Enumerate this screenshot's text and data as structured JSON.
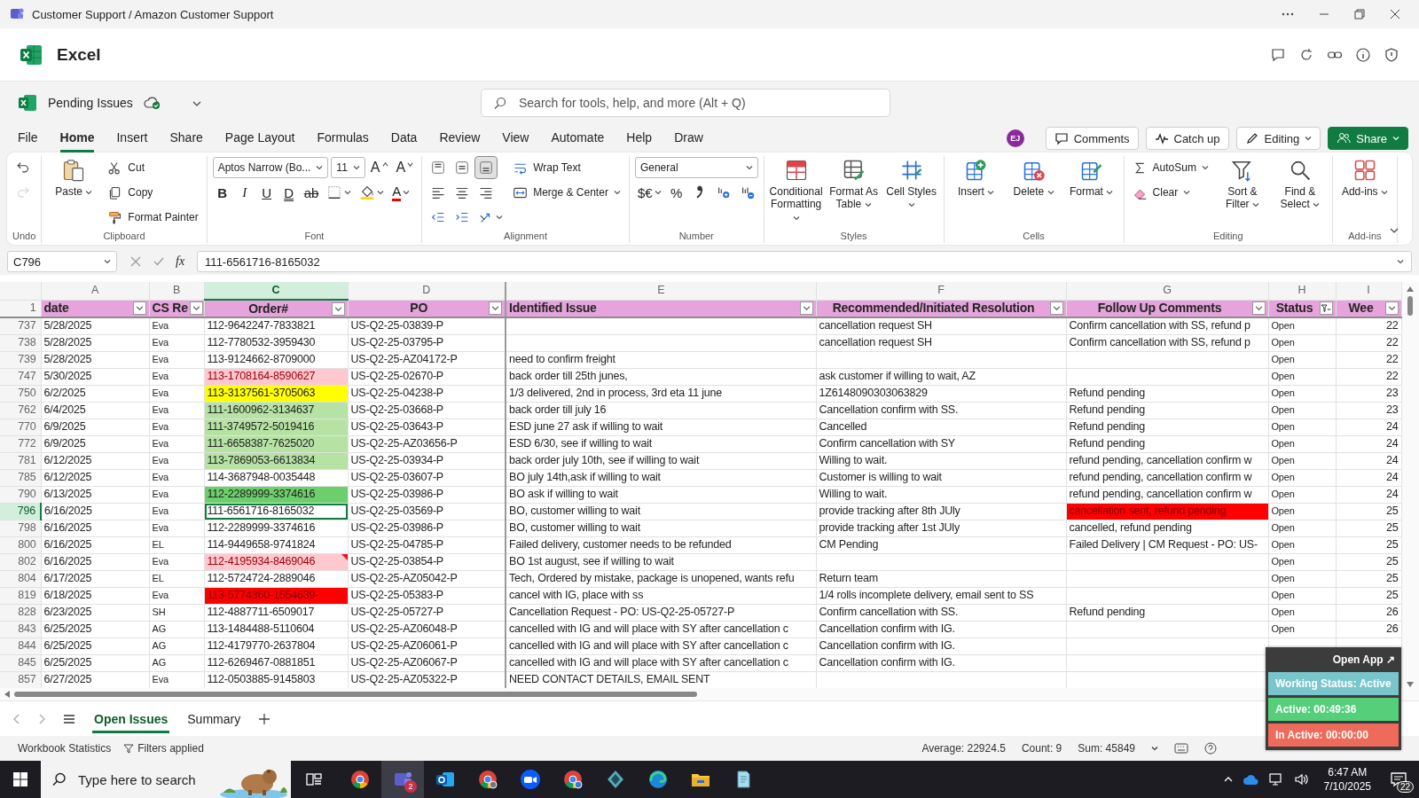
{
  "window": {
    "title": "Customer Support / Amazon Customer Support"
  },
  "app": {
    "name": "Excel"
  },
  "document": {
    "name": "Pending Issues"
  },
  "search": {
    "placeholder": "Search for tools, help, and more (Alt + Q)"
  },
  "menu_tabs": [
    {
      "label": "File",
      "selected": false
    },
    {
      "label": "Home",
      "selected": true
    },
    {
      "label": "Insert",
      "selected": false
    },
    {
      "label": "Share",
      "selected": false
    },
    {
      "label": "Page Layout",
      "selected": false
    },
    {
      "label": "Formulas",
      "selected": false
    },
    {
      "label": "Data",
      "selected": false
    },
    {
      "label": "Review",
      "selected": false
    },
    {
      "label": "View",
      "selected": false
    },
    {
      "label": "Automate",
      "selected": false
    },
    {
      "label": "Help",
      "selected": false
    },
    {
      "label": "Draw",
      "selected": false
    }
  ],
  "user": {
    "initials": "EJ"
  },
  "header_buttons": [
    {
      "label": "Comments",
      "kind": "comments",
      "caret": false
    },
    {
      "label": "Catch up",
      "kind": "catchup",
      "caret": false
    },
    {
      "label": "Editing",
      "kind": "editing",
      "caret": true
    },
    {
      "label": "Share",
      "kind": "share",
      "caret": true
    }
  ],
  "ribbon": [
    {
      "label": "Undo",
      "columns": [
        [
          [
            {
              "kind": "icon",
              "caret": false,
              "disabled": false,
              "selected": false
            }
          ],
          [
            {
              "kind": "icon",
              "caret": false,
              "disabled": true,
              "selected": false
            }
          ]
        ]
      ]
    },
    {
      "label": "Clipboard",
      "columns": [
        [
          [
            {
              "kind": "large",
              "label": "Paste",
              "caret": true
            }
          ]
        ],
        [
          [
            {
              "kind": "small",
              "label": "Cut",
              "caret": false
            }
          ],
          [
            {
              "kind": "small",
              "label": "Copy",
              "caret": false
            }
          ],
          [
            {
              "kind": "small",
              "label": "Format Painter",
              "caret": false
            }
          ]
        ]
      ]
    },
    {
      "label": "Font",
      "columns": [
        [
          [
            {
              "kind": "dropdown",
              "text": "Aptos Narrow (Bo...",
              "caret": true
            },
            {
              "kind": "dropdown",
              "text": "11",
              "caret": true
            },
            {
              "kind": "grow",
              "text": "A",
              "caret": false
            },
            {
              "kind": "shrink",
              "text": "A",
              "caret": false
            }
          ],
          [
            {
              "kind": "bold",
              "text": "B",
              "caret": false
            },
            {
              "kind": "italic",
              "text": "I",
              "caret": false
            },
            {
              "kind": "underline",
              "text": "U",
              "caret": false
            },
            {
              "kind": "double-underline",
              "text": "D",
              "caret": false
            },
            {
              "kind": "strike",
              "text": "ab",
              "caret": false
            },
            {
              "kind": "icon",
              "caret": true,
              "disabled": false,
              "selected": false
            },
            {
              "kind": "icon",
              "caret": true,
              "disabled": false,
              "selected": false
            },
            {
              "kind": "font-color",
              "text": "A",
              "caret": true
            }
          ]
        ]
      ]
    },
    {
      "label": "Alignment",
      "columns": [
        [
          [
            {
              "kind": "icon",
              "caret": false,
              "disabled": false,
              "selected": false
            },
            {
              "kind": "icon",
              "caret": false,
              "disabled": false,
              "selected": false
            },
            {
              "kind": "icon",
              "caret": false,
              "disabled": false,
              "selected": true
            }
          ],
          [
            {
              "kind": "icon",
              "caret": false,
              "disabled": false,
              "selected": false
            },
            {
              "kind": "icon",
              "caret": false,
              "disabled": false,
              "selected": false
            },
            {
              "kind": "icon",
              "caret": false,
              "disabled": false,
              "selected": false
            }
          ],
          [
            {
              "kind": "icon",
              "caret": false,
              "disabled": false,
              "selected": false
            },
            {
              "kind": "icon",
              "caret": false,
              "disabled": false,
              "selected": false
            },
            {
              "kind": "icon",
              "caret": true,
              "disabled": false,
              "selected": false
            }
          ]
        ],
        [
          [
            {
              "kind": "small",
              "label": "Wrap Text",
              "caret": false
            }
          ],
          [
            {
              "kind": "small",
              "label": "Merge & Center",
              "caret": true
            }
          ]
        ]
      ]
    },
    {
      "label": "Number",
      "columns": [
        [
          [
            {
              "kind": "dropdown",
              "text": "General",
              "caret": true
            }
          ],
          [
            {
              "kind": "text",
              "text": "$€",
              "caret": true
            },
            {
              "kind": "text",
              "text": "%",
              "caret": false
            },
            {
              "kind": "icon",
              "caret": false,
              "disabled": false,
              "selected": false
            },
            {
              "kind": "icon",
              "caret": false,
              "disabled": false,
              "selected": false
            },
            {
              "kind": "icon",
              "caret": false,
              "disabled": false,
              "selected": false
            }
          ]
        ]
      ]
    },
    {
      "label": "Styles",
      "columns": [
        [
          [
            {
              "kind": "large",
              "label": "Conditional Formatting",
              "caret": true
            }
          ]
        ],
        [
          [
            {
              "kind": "large",
              "label": "Format As Table",
              "caret": true
            }
          ]
        ],
        [
          [
            {
              "kind": "large",
              "label": "Cell Styles",
              "caret": true
            }
          ]
        ]
      ]
    },
    {
      "label": "Cells",
      "columns": [
        [
          [
            {
              "kind": "large",
              "label": "Insert",
              "caret": true
            }
          ]
        ],
        [
          [
            {
              "kind": "large",
              "label": "Delete",
              "caret": true
            }
          ]
        ],
        [
          [
            {
              "kind": "large",
              "label": "Format",
              "caret": true
            }
          ]
        ]
      ]
    },
    {
      "label": "Editing",
      "columns": [
        [
          [
            {
              "kind": "small",
              "label": "AutoSum",
              "caret": true
            }
          ],
          [
            {
              "kind": "small",
              "label": "Clear",
              "caret": true
            }
          ]
        ],
        [
          [
            {
              "kind": "large",
              "label": "Sort & Filter",
              "caret": true
            }
          ]
        ],
        [
          [
            {
              "kind": "large",
              "label": "Find & Select",
              "caret": true
            }
          ]
        ]
      ]
    },
    {
      "label": "Add-ins",
      "columns": [
        [
          [
            {
              "kind": "large",
              "label": "Add-ins",
              "caret": true
            }
          ]
        ]
      ]
    }
  ],
  "formula_bar": {
    "name_box": "C796",
    "function_label": "fx",
    "value": "111-6561716-8165032"
  },
  "columns": [
    {
      "letter": "A",
      "header": "date",
      "selected": false,
      "filtered": false
    },
    {
      "letter": "B",
      "header": "CS Re",
      "selected": false,
      "filtered": false
    },
    {
      "letter": "C",
      "header": "Order#",
      "selected": true,
      "filtered": false
    },
    {
      "letter": "D",
      "header": "PO",
      "selected": false,
      "filtered": false
    },
    {
      "letter": "E",
      "header": "Identified Issue",
      "selected": false,
      "filtered": false
    },
    {
      "letter": "F",
      "header": "Recommended/Initiated Resolution",
      "selected": false,
      "filtered": false
    },
    {
      "letter": "G",
      "header": "Follow Up Comments",
      "selected": false,
      "filtered": false
    },
    {
      "letter": "H",
      "header": "Status",
      "selected": false,
      "filtered": true
    },
    {
      "letter": "I",
      "header": "Wee",
      "selected": false,
      "filtered": false
    }
  ],
  "header_row": "1",
  "rows": [
    {
      "header": "737",
      "selected": false,
      "note": false,
      "date": "5/28/2025",
      "rep": "Eva",
      "order": "112-9642247-7833821",
      "po": "US-Q2-25-03839-P",
      "resolution": "cancellation request SH",
      "follow_up": "Confirm cancellation with SS, refund p",
      "status": "Open",
      "week": "22"
    },
    {
      "header": "738",
      "selected": false,
      "note": false,
      "date": "5/28/2025",
      "rep": "Eva",
      "order": "112-7780532-3959430",
      "po": "US-Q2-25-03795-P",
      "resolution": "cancellation request SH",
      "follow_up": "Confirm cancellation with SS, refund p",
      "status": "Open",
      "week": "22"
    },
    {
      "header": "739",
      "selected": false,
      "note": false,
      "date": "5/28/2025",
      "rep": "Eva",
      "order": "113-9124662-8709000",
      "po": " US-Q2-25-AZ04172-P",
      "issue": "need to confirm freight",
      "status": "Open",
      "week": "22"
    },
    {
      "header": "747",
      "selected": false,
      "note": false,
      "date": "5/30/2025",
      "rep": "Eva",
      "order": {
        "text": "113-1708164-8590627",
        "color": "#ffc7ce"
      },
      "po": "US-Q2-25-02670-P",
      "issue": "back order till 25th junes,",
      "resolution": "ask customer if willing to wait, AZ",
      "status": "Open",
      "week": "22"
    },
    {
      "header": "750",
      "selected": false,
      "note": false,
      "date": "6/2/2025",
      "rep": "Eva",
      "order": {
        "text": "113-3137561-3705063",
        "color": "#ffff00"
      },
      "po": "US-Q2-25-04238-P",
      "issue": "1/3 delivered, 2nd in process, 3rd eta 11 june",
      "resolution": "1Z6148090303063829",
      "follow_up": "Refund pending",
      "status": "Open",
      "week": "23"
    },
    {
      "header": "762",
      "selected": false,
      "note": false,
      "date": "6/4/2025",
      "rep": "Eva",
      "order": {
        "text": "111-1600962-3134637",
        "color": "#b6e2a4"
      },
      "po": "US-Q2-25-03668-P",
      "issue": "back order till july 16",
      "resolution": "Cancellation confirm with SS.",
      "follow_up": "Refund pending",
      "status": "Open",
      "week": "23"
    },
    {
      "header": "770",
      "selected": false,
      "note": false,
      "date": "6/9/2025",
      "rep": "Eva",
      "order": {
        "text": "111-3749572-5019416",
        "color": "#b6e2a4"
      },
      "po": " US-Q2-25-03643-P",
      "issue": "ESD june 27 ask if willing to wait",
      "resolution": "Cancelled",
      "follow_up": "Refund pending",
      "status": "Open",
      "week": "24"
    },
    {
      "header": "772",
      "selected": false,
      "note": false,
      "date": "6/9/2025",
      "rep": "Eva",
      "order": {
        "text": "111-6658387-7625020",
        "color": "#b6e2a4"
      },
      "po": "US-Q2-25-AZ03656-P",
      "issue": "ESD 6/30, see if willing to wait",
      "resolution": "Confirm cancellation with SY",
      "follow_up": "Refund pending",
      "status": "Open",
      "week": "24"
    },
    {
      "header": "781",
      "selected": false,
      "note": false,
      "date": "6/12/2025",
      "rep": "Eva",
      "order": {
        "text": "113-7869053-6613834",
        "color": "#b6e2a4"
      },
      "po": "US-Q2-25-03934-P",
      "issue": "back order july 10th, see if willing to wait",
      "resolution": "Willing to wait.",
      "follow_up": "refund pending, cancellation confirm w",
      "status": "Open",
      "week": "24"
    },
    {
      "header": "785",
      "selected": false,
      "note": false,
      "date": "6/12/2025",
      "rep": "Eva",
      "order": "114-3687948-0035448",
      "po": "US-Q2-25-03607-P",
      "issue": "BO july 14th,ask if willing to wait",
      "resolution": "Customer is willing to wait",
      "follow_up": "refund pending, cancellation confirm w",
      "status": "Open",
      "week": "24"
    },
    {
      "header": "790",
      "selected": false,
      "note": false,
      "date": "6/13/2025",
      "rep": "Eva",
      "order": {
        "text": "112-2289999-3374616",
        "color": "#6ccf6b"
      },
      "po": "US-Q2-25-03986-P",
      "issue": "BO ask if willing to wait",
      "resolution": "Willing to wait.",
      "follow_up": "refund pending, cancellation confirm w",
      "status": "Open",
      "week": "24"
    },
    {
      "header": "796",
      "selected": true,
      "note": false,
      "date": "6/16/2025",
      "rep": "Eva",
      "order": "111-6561716-8165032",
      "po": "US-Q2-25-03569-P",
      "issue": "BO, customer willing to wait",
      "resolution": "provide tracking after 8th JUly",
      "follow_up": {
        "text": "cancellation sent, refund pending",
        "color": "#ff0000"
      },
      "status": "Open",
      "week": "25"
    },
    {
      "header": "798",
      "selected": false,
      "note": false,
      "date": "6/16/2025",
      "rep": "Eva",
      "order": "112-2289999-3374616",
      "po": "US-Q2-25-03986-P",
      "issue": "BO, customer willing to wait",
      "resolution": "provide tracking after 1st JUly",
      "follow_up": "cancelled, refund pending",
      "status": "Open",
      "week": "25"
    },
    {
      "header": "800",
      "selected": false,
      "note": false,
      "date": "6/16/2025",
      "rep": "EL",
      "order": "114-9449658-9741824",
      "po": "US-Q2-25-04785-P",
      "issue": "Failed delivery, customer needs to be refunded",
      "resolution": "CM Pending",
      "follow_up": "Failed Delivery | CM Request - PO: US-",
      "status": "Open",
      "week": "25"
    },
    {
      "header": "802",
      "selected": false,
      "note": true,
      "date": "6/16/2025",
      "rep": "Eva",
      "order": {
        "text": "112-4195934-8469046",
        "color": "#ffc7ce"
      },
      "po": "US-Q2-25-03854-P",
      "issue": "BO 1st august, see if willing to wait",
      "status": "Open",
      "week": "25"
    },
    {
      "header": "804",
      "selected": false,
      "note": false,
      "date": "6/17/2025",
      "rep": "EL",
      "order": "112-5724724-2889046",
      "po": "US-Q2-25-AZ05042-P",
      "issue": "Tech, Ordered by mistake, package is unopened, wants refu",
      "resolution": "Return team",
      "status": "Open",
      "week": "25"
    },
    {
      "header": "819",
      "selected": false,
      "note": false,
      "date": "6/18/2025",
      "rep": "Eva",
      "order": {
        "text": "113-5774360-1554639-",
        "color": "#ff0000"
      },
      "po": "US-Q2-25-05383-P",
      "issue": "cancel with IG, place with ss",
      "resolution": "1/4 rolls incomplete delivery, email sent to SS",
      "status": "Open",
      "week": "25"
    },
    {
      "header": "828",
      "selected": false,
      "note": false,
      "date": "6/23/2025",
      "rep": "SH",
      "order": "112-4887711-6509017",
      "po": "US-Q2-25-05727-P",
      "issue": "Cancellation Request - PO: US-Q2-25-05727-P",
      "resolution": "Confirm cancellation with SS.",
      "follow_up": "Refund pending",
      "status": "Open",
      "week": "26"
    },
    {
      "header": "843",
      "selected": false,
      "note": false,
      "date": "6/25/2025",
      "rep": "AG",
      "order": "113-1484488-5110604",
      "po": "US-Q2-25-AZ06048-P",
      "issue": "cancelled with IG and will place with SY after cancellation c",
      "resolution": "Cancellation confirm with IG.",
      "status": "Open",
      "week": "26"
    },
    {
      "header": "844",
      "selected": false,
      "note": false,
      "date": "6/25/2025",
      "rep": "AG",
      "order": "112-4179770-2637804",
      "po": "US-Q2-25-AZ06061-P",
      "issue": "cancelled with IG and will place with SY after cancellation c",
      "resolution": "Cancellation confirm with IG."
    },
    {
      "header": "845",
      "selected": false,
      "note": false,
      "date": "6/25/2025",
      "rep": "AG",
      "order": "112-6269467-0881851",
      "po": "US-Q2-25-AZ06067-P",
      "issue": "cancelled with IG and will place with SY after cancellation c",
      "resolution": "Cancellation confirm with IG."
    },
    {
      "header": "857",
      "selected": false,
      "note": false,
      "date": "6/27/2025",
      "rep": "Eva",
      "order": "112-0503885-9145803",
      "po": "US-Q2-25-AZ05322-P",
      "issue": "NEED CONTACT DETAILS, EMAIL SENT"
    }
  ],
  "sheet_tabs": [
    {
      "label": "Open Issues",
      "selected": true
    },
    {
      "label": "Summary",
      "selected": false
    }
  ],
  "status_bar": {
    "left": [
      "Workbook Statistics",
      "Filters applied"
    ],
    "stats": [
      "Average: 22924.5",
      "Count: 9",
      "Sum: 45849"
    ]
  },
  "tracker": {
    "open_app": "Open App ↗",
    "statuses": [
      {
        "label": "Working Status: Active",
        "color": "#78c6cc"
      },
      {
        "label": "Active: 00:49:36",
        "color": "#55cf7a"
      },
      {
        "label": "In Active: 00:00:00",
        "color": "#ee6a5a"
      }
    ]
  },
  "taskbar": {
    "search_placeholder": "Type here to search",
    "apps": [
      {
        "selected": false
      },
      {
        "selected": true,
        "badge": "2"
      },
      {
        "selected": false
      },
      {
        "selected": false
      },
      {
        "selected": false
      },
      {
        "selected": false
      },
      {
        "selected": false
      },
      {
        "selected": false
      },
      {
        "selected": false
      },
      {
        "selected": false
      }
    ],
    "time": "6:47 AM",
    "date": "7/10/2025",
    "notifications": "22"
  }
}
